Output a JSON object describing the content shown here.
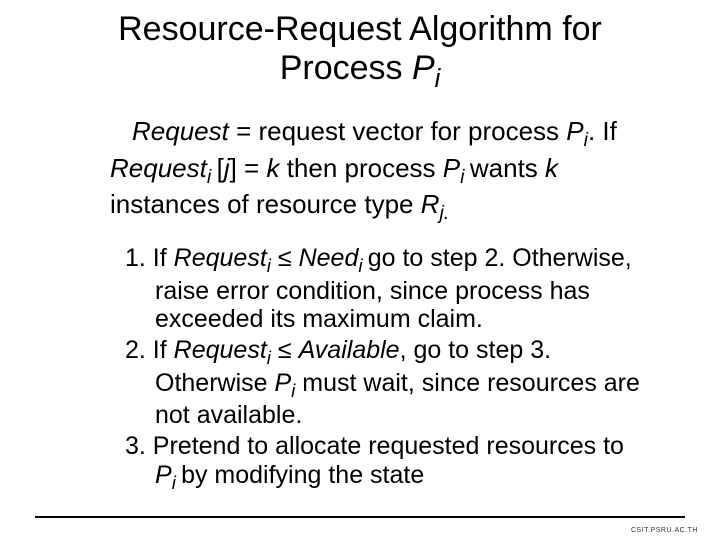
{
  "title": {
    "line1": "Resource-Request Algorithm for",
    "line2_pre": "Process ",
    "line2_p": "P",
    "line2_sub": "i"
  },
  "intro": {
    "t1": "Request",
    "t2": " = request vector for process ",
    "t3": "P",
    "t4": "i",
    "t5": ".  If ",
    "t6": "Request",
    "t7": "i ",
    "t8": "[",
    "t9": "j",
    "t10": "] = ",
    "t11": "k",
    "t12": " then process ",
    "t13": "P",
    "t14": "i ",
    "t15": "wants ",
    "t16": "k",
    "t17": " instances of resource type ",
    "t18": "R",
    "t19": "j."
  },
  "steps": {
    "s1_num": "1.",
    "s1a": "  If ",
    "s1b": "Request",
    "s1c": "i",
    "s1d": " ≤ ",
    "s1e": "Need",
    "s1f": "i ",
    "s1g": "go to step 2.  Otherwise, raise error condition, since process has exceeded its maximum claim.",
    "s2_num": "2.",
    "s2a": "  If ",
    "s2b": "Request",
    "s2c": "i",
    "s2d": " ≤ ",
    "s2e": "Available",
    "s2f": ", go to step 3.  Otherwise ",
    "s2g": "P",
    "s2h": "i",
    "s2i": "  must wait, since resources are not available.",
    "s3_num": "3.",
    "s3a": "  Pretend to allocate requested resources to ",
    "s3b": "P",
    "s3c": "i ",
    "s3d": "by modifying the state"
  },
  "footer": "CSIT.PSRU.AC.TH"
}
